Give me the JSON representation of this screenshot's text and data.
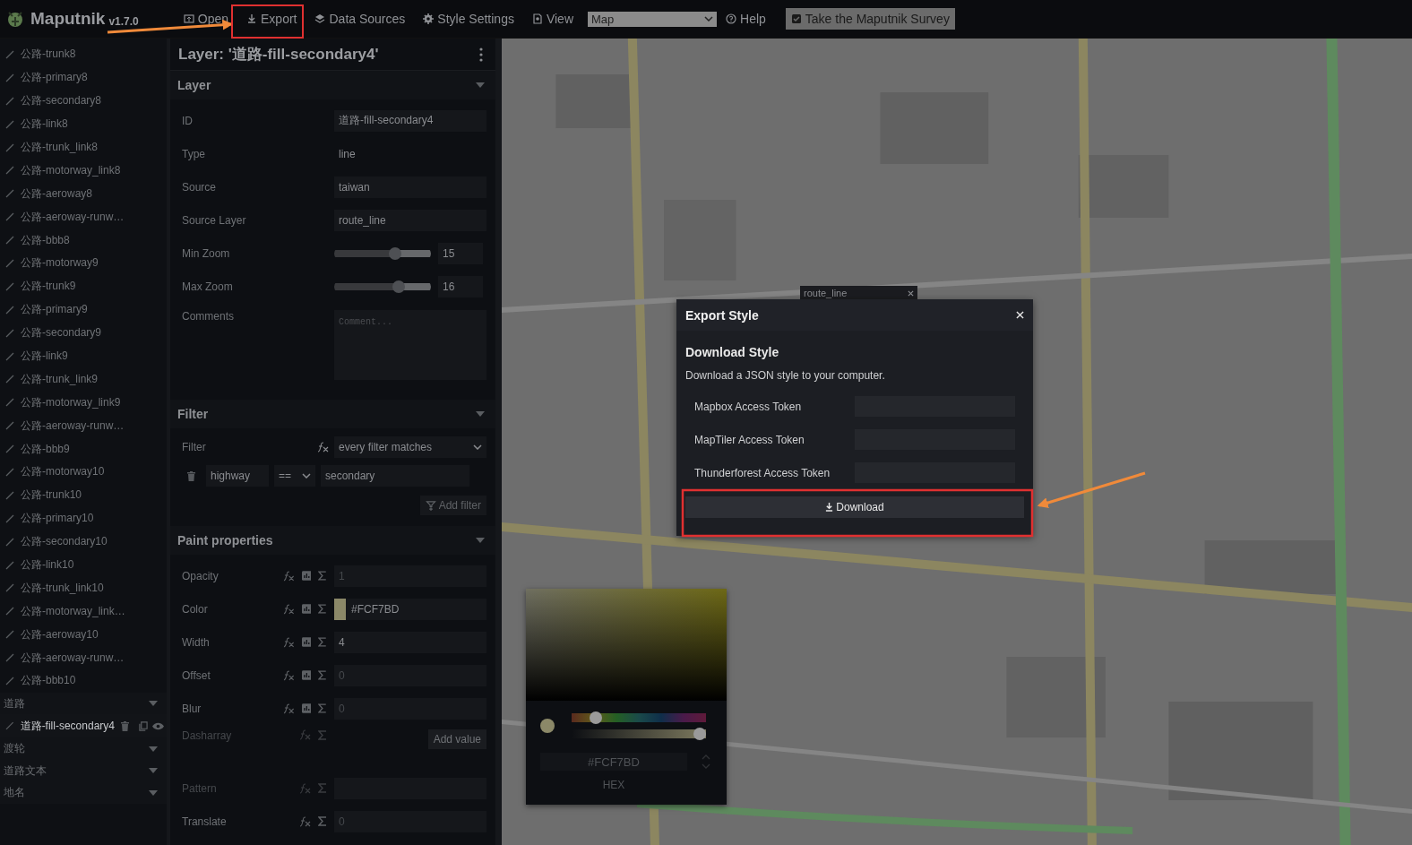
{
  "app": {
    "name": "Maputnik",
    "version": "v1.7.0"
  },
  "toolbar": [
    {
      "kind": "button",
      "label": "Open"
    },
    {
      "kind": "button",
      "label": "Export"
    },
    {
      "kind": "button",
      "label": "Data Sources"
    },
    {
      "kind": "button",
      "label": "Style Settings"
    },
    {
      "kind": "select",
      "label": "View",
      "value": "Map"
    },
    {
      "kind": "button",
      "label": "Help"
    },
    {
      "kind": "survey",
      "label": "Take the Maputnik Survey"
    }
  ],
  "layers": [
    {
      "kind": "layer",
      "name": "公路-trunk8",
      "selected": false
    },
    {
      "kind": "layer",
      "name": "公路-primary8",
      "selected": false
    },
    {
      "kind": "layer",
      "name": "公路-secondary8",
      "selected": false
    },
    {
      "kind": "layer",
      "name": "公路-link8",
      "selected": false
    },
    {
      "kind": "layer",
      "name": "公路-trunk_link8",
      "selected": false
    },
    {
      "kind": "layer",
      "name": "公路-motorway_link8",
      "selected": false
    },
    {
      "kind": "layer",
      "name": "公路-aeroway8",
      "selected": false
    },
    {
      "kind": "layer",
      "name": "公路-aeroway-runw…",
      "selected": false
    },
    {
      "kind": "layer",
      "name": "公路-bbb8",
      "selected": false
    },
    {
      "kind": "layer",
      "name": "公路-motorway9",
      "selected": false
    },
    {
      "kind": "layer",
      "name": "公路-trunk9",
      "selected": false
    },
    {
      "kind": "layer",
      "name": "公路-primary9",
      "selected": false
    },
    {
      "kind": "layer",
      "name": "公路-secondary9",
      "selected": false
    },
    {
      "kind": "layer",
      "name": "公路-link9",
      "selected": false
    },
    {
      "kind": "layer",
      "name": "公路-trunk_link9",
      "selected": false
    },
    {
      "kind": "layer",
      "name": "公路-motorway_link9",
      "selected": false
    },
    {
      "kind": "layer",
      "name": "公路-aeroway-runw…",
      "selected": false
    },
    {
      "kind": "layer",
      "name": "公路-bbb9",
      "selected": false
    },
    {
      "kind": "layer",
      "name": "公路-motorway10",
      "selected": false
    },
    {
      "kind": "layer",
      "name": "公路-trunk10",
      "selected": false
    },
    {
      "kind": "layer",
      "name": "公路-primary10",
      "selected": false
    },
    {
      "kind": "layer",
      "name": "公路-secondary10",
      "selected": false
    },
    {
      "kind": "layer",
      "name": "公路-link10",
      "selected": false
    },
    {
      "kind": "layer",
      "name": "公路-trunk_link10",
      "selected": false
    },
    {
      "kind": "layer",
      "name": "公路-motorway_link…",
      "selected": false
    },
    {
      "kind": "layer",
      "name": "公路-aeroway10",
      "selected": false
    },
    {
      "kind": "layer",
      "name": "公路-aeroway-runw…",
      "selected": false
    },
    {
      "kind": "layer",
      "name": "公路-bbb10",
      "selected": false
    },
    {
      "kind": "group",
      "name": "道路",
      "children": [
        {
          "kind": "layer",
          "name": "道路-fill-secondary4",
          "selected": true
        }
      ]
    },
    {
      "kind": "group",
      "name": "渡轮"
    },
    {
      "kind": "group",
      "name": "道路文本"
    },
    {
      "kind": "group",
      "name": "地名"
    }
  ],
  "editor": {
    "title": "Layer: '道路-fill-secondary4'",
    "layer_section": {
      "title": "Layer",
      "fields": [
        {
          "kind": "input",
          "label": "ID",
          "value": "道路-fill-secondary4"
        },
        {
          "kind": "text",
          "label": "Type",
          "value": "line"
        },
        {
          "kind": "input",
          "label": "Source",
          "value": "taiwan"
        },
        {
          "kind": "input",
          "label": "Source Layer",
          "value": "route_line"
        },
        {
          "kind": "slider",
          "label": "Min Zoom",
          "level": 0.625,
          "value": "15"
        },
        {
          "kind": "slider",
          "label": "Max Zoom",
          "level": 0.667,
          "value": "16"
        },
        {
          "kind": "textarea",
          "label": "Comments",
          "placeholder": "Comment..."
        }
      ]
    },
    "filter_section": {
      "title": "Filter",
      "label": "Filter",
      "combinator": "every filter matches",
      "rows": [
        {
          "key": "highway",
          "operator": "==",
          "value": "secondary"
        }
      ],
      "add_button": "Add filter"
    },
    "paint_section": {
      "title": "Paint properties",
      "properties": [
        {
          "kind": "input",
          "label": "Opacity",
          "disabled": false,
          "data_driven": true,
          "placeholder": "1"
        },
        {
          "kind": "color",
          "label": "Color",
          "disabled": false,
          "data_driven": true,
          "value": "#FCF7BD"
        },
        {
          "kind": "input",
          "label": "Width",
          "disabled": false,
          "data_driven": true,
          "value": "4"
        },
        {
          "kind": "input",
          "label": "Offset",
          "disabled": false,
          "data_driven": true,
          "placeholder": "0"
        },
        {
          "kind": "input",
          "label": "Blur",
          "disabled": false,
          "data_driven": true,
          "placeholder": "0"
        },
        {
          "kind": "array",
          "label": "Dasharray",
          "disabled": true,
          "data_driven": false,
          "button": "Add value"
        },
        {
          "kind": "input",
          "label": "Pattern",
          "disabled": true,
          "data_driven": false
        },
        {
          "kind": "input",
          "label": "Translate",
          "disabled": false,
          "data_driven": false,
          "placeholder": "0"
        }
      ]
    }
  },
  "map": {
    "popup": {
      "label": "route_line"
    }
  },
  "color_picker": {
    "hue_slider": {
      "level": 0.15
    },
    "alpha_slider": {
      "level": 1
    },
    "value": "#FCF7BD",
    "mode": "HEX"
  },
  "export_dialog": {
    "title": "Export Style",
    "heading": "Download Style",
    "description": "Download a JSON style to your computer.",
    "tokens": [
      {
        "label": "Mapbox Access Token"
      },
      {
        "label": "MapTiler Access Token"
      },
      {
        "label": "Thunderforest Access Token"
      }
    ],
    "button": "Download"
  }
}
